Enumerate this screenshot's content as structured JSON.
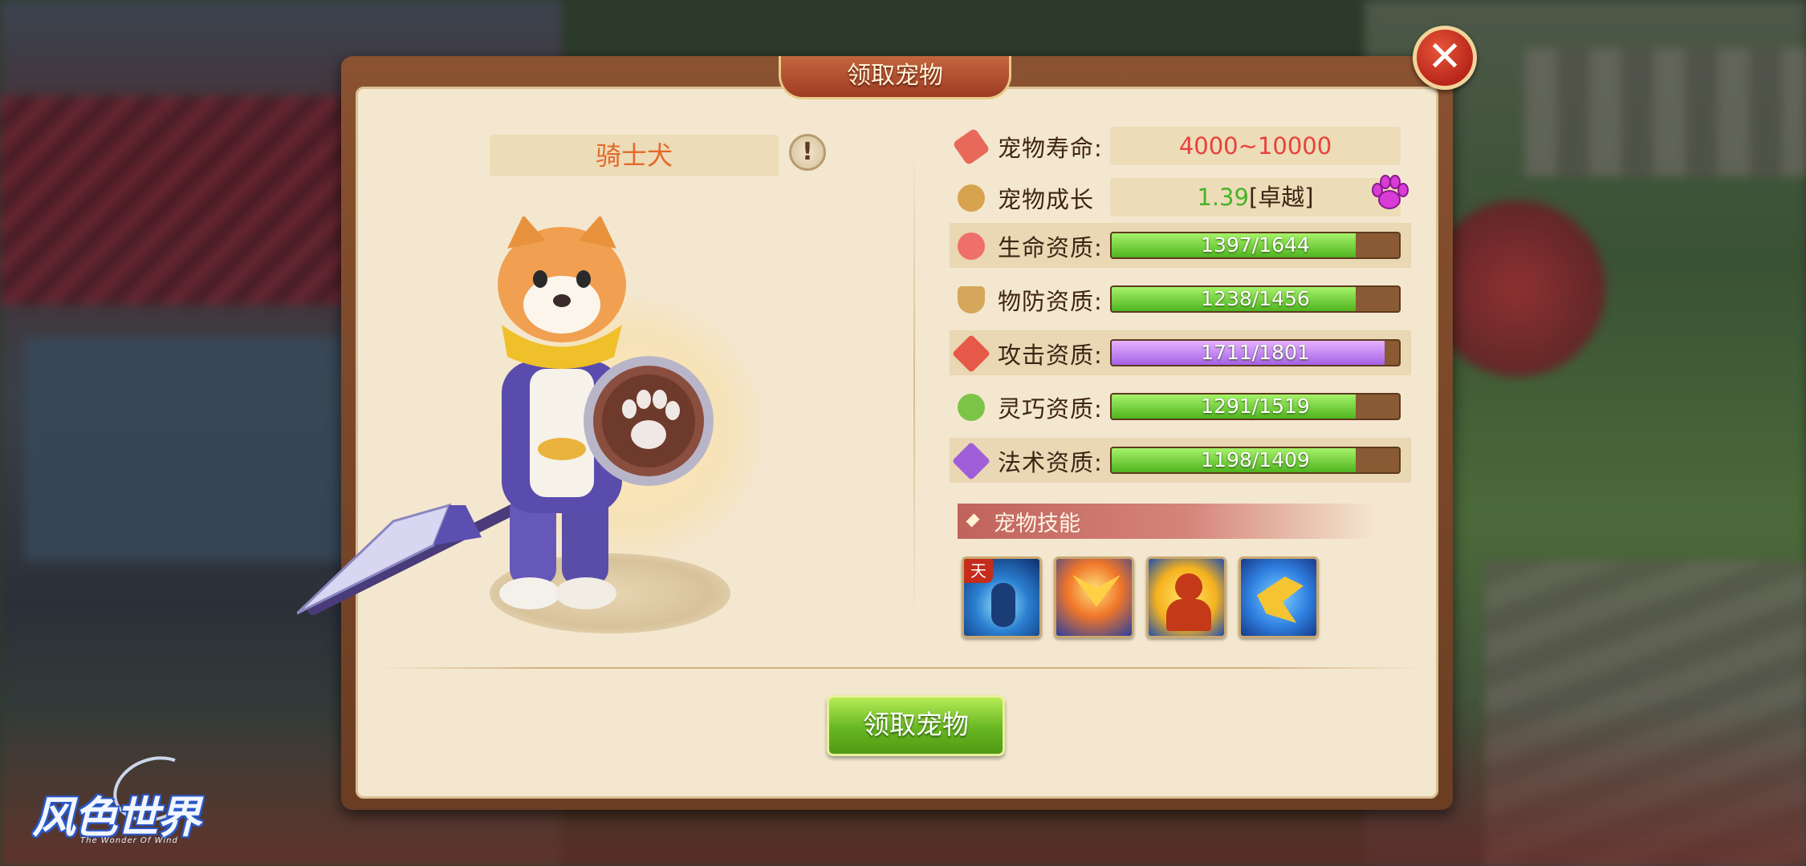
{
  "dialog": {
    "title": "领取宠物",
    "claim_label": "领取宠物"
  },
  "pet": {
    "name": "骑士犬",
    "info_glyph": "!"
  },
  "stats": {
    "lifespan_label": "宠物寿命:",
    "lifespan_value": "4000~10000",
    "growth_label": "宠物成长",
    "growth_value": "1.39",
    "growth_rank": "[卓越]",
    "aptitudes": [
      {
        "label": "生命资质:",
        "text": "1397/1644",
        "fraction": 0.85,
        "color": "green",
        "icon": "heart-icon"
      },
      {
        "label": "物防资质:",
        "text": "1238/1456",
        "fraction": 0.85,
        "color": "green",
        "icon": "shield-icon"
      },
      {
        "label": "攻击资质:",
        "text": "1711/1801",
        "fraction": 0.95,
        "color": "purple",
        "icon": "sword-icon"
      },
      {
        "label": "灵巧资质:",
        "text": "1291/1519",
        "fraction": 0.85,
        "color": "green",
        "icon": "agility-icon"
      },
      {
        "label": "法术资质:",
        "text": "1198/1409",
        "fraction": 0.85,
        "color": "green",
        "icon": "magic-star-icon"
      }
    ]
  },
  "skills": {
    "header": "宠物技能",
    "items": [
      {
        "icon": "spirit-skill-icon",
        "tag": "天"
      },
      {
        "icon": "phoenix-skill-icon"
      },
      {
        "icon": "power-skill-icon"
      },
      {
        "icon": "strike-skill-icon"
      }
    ]
  },
  "logo": {
    "text": "风色世界",
    "subtitle": "The Wonder Of Wind"
  },
  "colors": {
    "lifespan_value": "#e8423c",
    "growth_value": "#47b42a",
    "pet_name": "#e36a2b",
    "bar_green": "#58c223",
    "bar_purple": "#b06ae8"
  }
}
